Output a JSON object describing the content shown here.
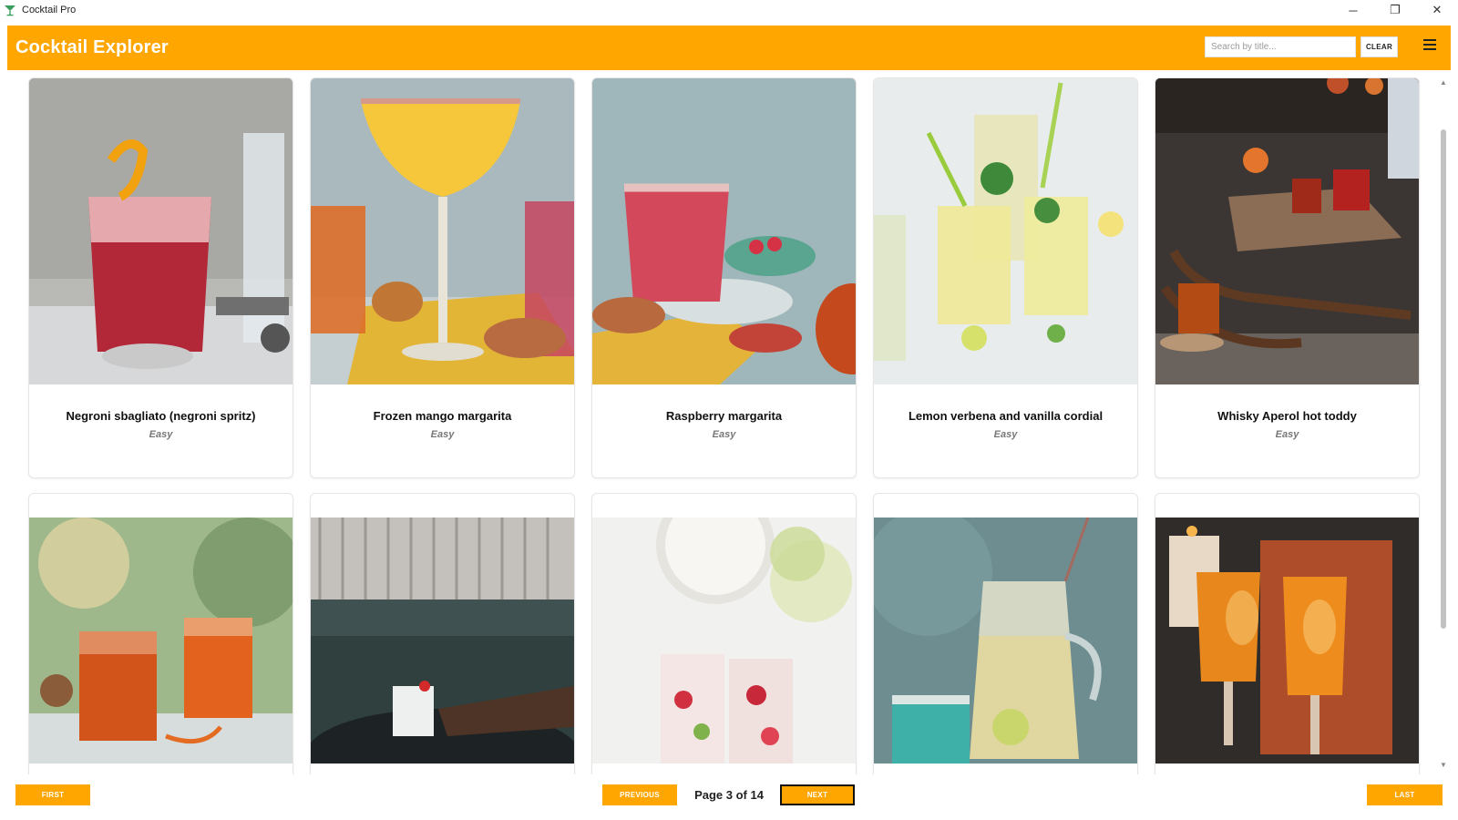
{
  "window": {
    "title": "Cocktail Pro",
    "controls": [
      "─",
      "❐",
      "✕"
    ]
  },
  "header": {
    "title": "Cocktail Explorer",
    "search_placeholder": "Search by title...",
    "clear_label": "CLEAR",
    "accent_color": "#ffa600"
  },
  "cards_row1": [
    {
      "title": "Negroni sbagliato (negroni spritz)",
      "difficulty": "Easy"
    },
    {
      "title": "Frozen mango margarita",
      "difficulty": "Easy"
    },
    {
      "title": "Raspberry margarita",
      "difficulty": "Easy"
    },
    {
      "title": "Lemon verbena and vanilla cordial",
      "difficulty": "Easy"
    },
    {
      "title": "Whisky Aperol hot toddy",
      "difficulty": "Easy"
    }
  ],
  "pagination": {
    "first_label": "FIRST",
    "previous_label": "PREVIOUS",
    "page_label": "Page 3 of 14",
    "next_label": "NEXT",
    "last_label": "LAST"
  },
  "scrollbar": {
    "up": "▲",
    "down": "▼"
  }
}
